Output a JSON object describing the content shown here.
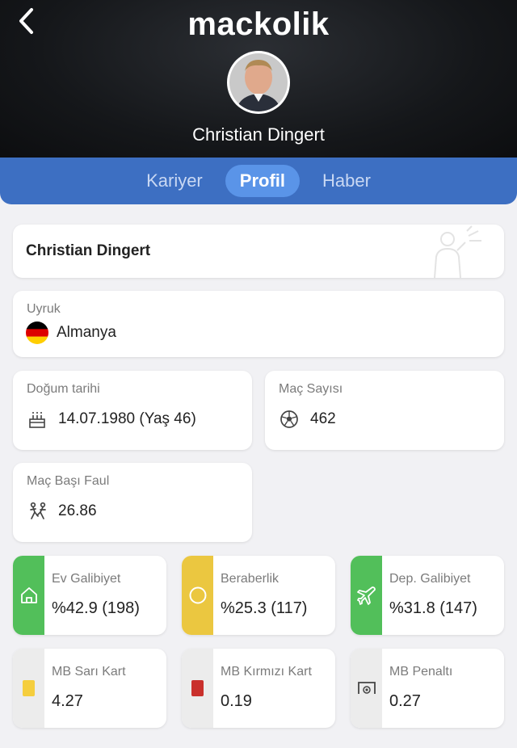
{
  "header": {
    "logo": "mackolik",
    "player_name": "Christian Dingert"
  },
  "tabs": [
    {
      "label": "Kariyer"
    },
    {
      "label": "Profil"
    },
    {
      "label": "Haber"
    }
  ],
  "profile": {
    "name": "Christian Dingert",
    "nationality": {
      "label": "Uyruk",
      "value": "Almanya",
      "flag_colors": [
        "#000000",
        "#dd0000",
        "#ffce00"
      ]
    },
    "birth": {
      "label": "Doğum tarihi",
      "value": "14.07.1980 (Yaş 46)",
      "icon": "cake-icon"
    },
    "matches": {
      "label": "Maç Sayısı",
      "value": "462",
      "icon": "soccer-ball-icon"
    },
    "fouls": {
      "label": "Maç Başı Faul",
      "value": "26.86",
      "icon": "foul-icon"
    }
  },
  "stats": {
    "home_win": {
      "label": "Ev Galibiyet",
      "value": "%42.9 (198)",
      "color": "#52bf5a",
      "icon": "home-icon"
    },
    "draw": {
      "label": "Beraberlik",
      "value": "%25.3 (117)",
      "color": "#ebc740",
      "icon": "circle-icon"
    },
    "away_win": {
      "label": "Dep. Galibiyet",
      "value": "%31.8 (147)",
      "color": "#52bf5a",
      "icon": "plane-icon"
    },
    "yellow": {
      "label": "MB Sarı Kart",
      "value": "4.27",
      "color": "#f5ce3e",
      "icon": "yellow-card-icon"
    },
    "red": {
      "label": "MB Kırmızı Kart",
      "value": "0.19",
      "color": "#c9302c",
      "icon": "red-card-icon"
    },
    "penalty": {
      "label": "MB Penaltı",
      "value": "0.27",
      "icon": "penalty-goal-icon"
    }
  }
}
